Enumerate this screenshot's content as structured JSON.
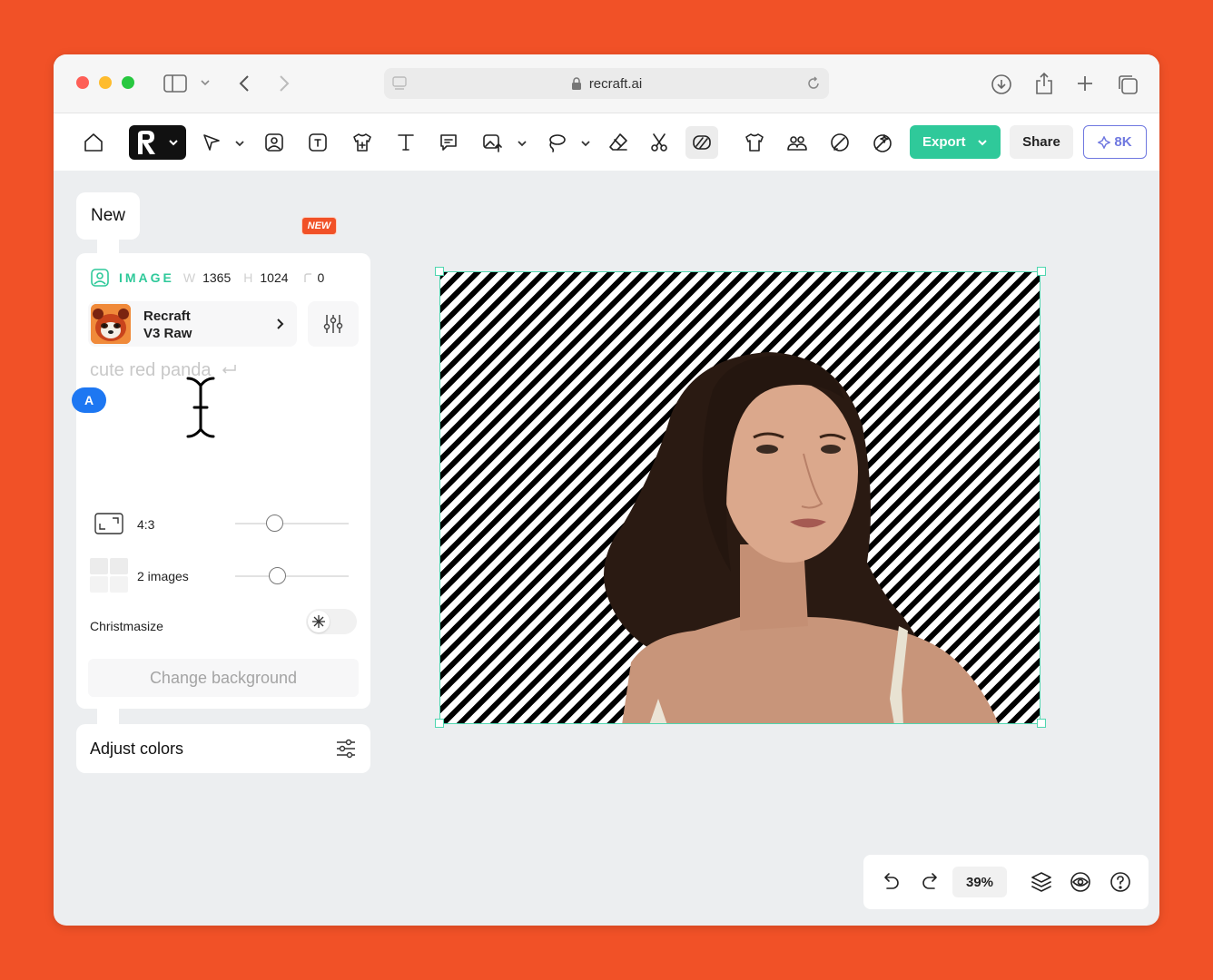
{
  "browser": {
    "url": "recraft.ai"
  },
  "toolbar": {
    "new_badge": "NEW",
    "export_label": "Export",
    "share_label": "Share",
    "credits_label": "8K"
  },
  "panel": {
    "new_label": "New",
    "image_label": "IMAGE",
    "width_label": "W",
    "width_value": "1365",
    "height_label": "H",
    "height_value": "1024",
    "rotation_value": "0",
    "model_line1": "Recraft",
    "model_line2": "V3 Raw",
    "prompt_placeholder": "cute red panda",
    "user_initial": "A",
    "aspect_label": "4:3",
    "aspect_slider": 0.35,
    "images_label": "2 images",
    "images_slider": 0.37,
    "christmasize_label": "Christmasize",
    "christmasize_on": false,
    "change_background_label": "Change background",
    "adjust_colors_label": "Adjust colors"
  },
  "bottom_bar": {
    "zoom": "39%"
  },
  "colors": {
    "background": "#f15127",
    "accent_green": "#2fc99a",
    "credits_purple": "#6f78e0",
    "selection": "#4fd6b0",
    "user_blue": "#1d77f2"
  },
  "icons": [
    "home-icon",
    "recraft-logo",
    "pen-tool-icon",
    "image-icon",
    "image-text-icon",
    "shirt-plus-icon",
    "text-icon",
    "comment-icon",
    "image-upload-icon",
    "lasso-icon",
    "eraser-icon",
    "scissors-icon",
    "remove-bg-icon",
    "tshirt-icon",
    "group-icon",
    "pencil-shape-icon",
    "magic-brush-icon",
    "undo-icon",
    "redo-icon",
    "layers-icon",
    "eye-icon",
    "help-icon"
  ]
}
